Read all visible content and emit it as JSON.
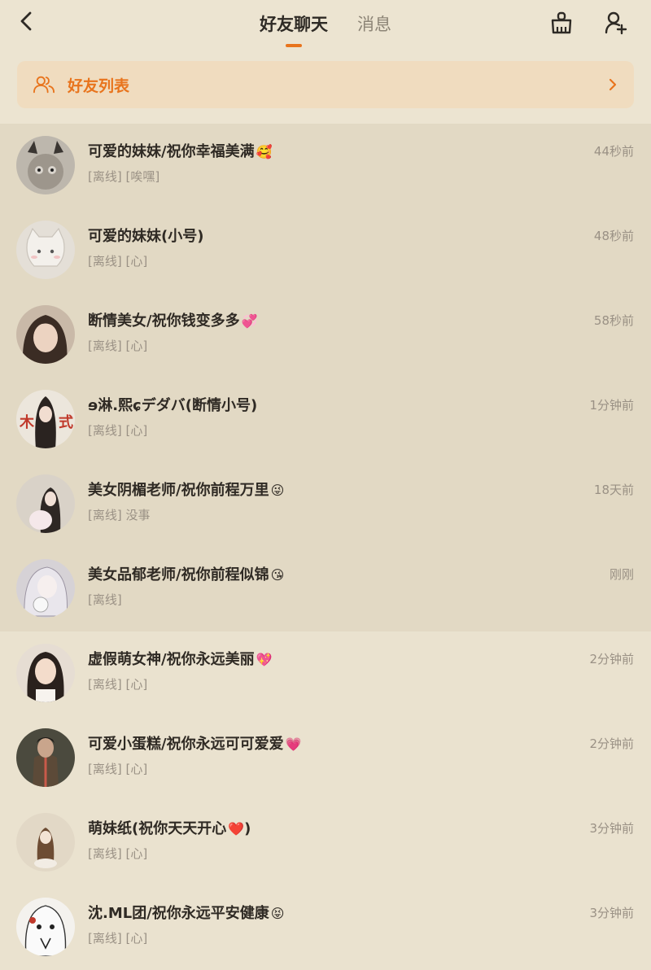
{
  "header": {
    "tabs": [
      {
        "label": "好友聊天",
        "active": true
      },
      {
        "label": "消息",
        "active": false
      }
    ]
  },
  "friend_list": {
    "label": "好友列表"
  },
  "colors": {
    "accent": "#e8741d"
  },
  "conversations_top": [
    {
      "name": "可爱的妹妹/祝你幸福美满",
      "emoji": "🥰",
      "status": "[离线] [唉嘿]",
      "time": "44秒前"
    },
    {
      "name": "可爱的妹妹(小号)",
      "emoji": "",
      "status": "[离线] [心]",
      "time": "48秒前"
    },
    {
      "name": "断情美女/祝你钱变多多",
      "emoji": "💞",
      "status": "[离线] [心]",
      "time": "58秒前"
    },
    {
      "name": "ɘ淋.熙ɕデダバ(断情小号)",
      "emoji": "",
      "status": "[离线] [心]",
      "time": "1分钟前"
    },
    {
      "name": "美女阴楣老师/祝你前程万里",
      "emoji": "😜",
      "status": "[离线] 没事",
      "time": "18天前"
    },
    {
      "name": "美女品郁老师/祝你前程似锦",
      "emoji": "😘",
      "status": "[离线]",
      "time": "刚刚"
    }
  ],
  "conversations_bottom": [
    {
      "name": "虚假萌女神/祝你永远美丽",
      "emoji": "💖",
      "status": "[离线] [心]",
      "time": "2分钟前"
    },
    {
      "name": "可爱小蛋糕/祝你永远可可爱爱",
      "emoji": "💗",
      "status": "[离线] [心]",
      "time": "2分钟前"
    },
    {
      "name": "萌妹纸(祝你天天开心",
      "emoji": "❤️",
      "name_suffix": ")",
      "status": "[离线] [心]",
      "time": "3分钟前"
    },
    {
      "name": "沈.ML团/祝你永远平安健康",
      "emoji": "😝",
      "status": "[离线] [心]",
      "time": "3分钟前"
    }
  ]
}
